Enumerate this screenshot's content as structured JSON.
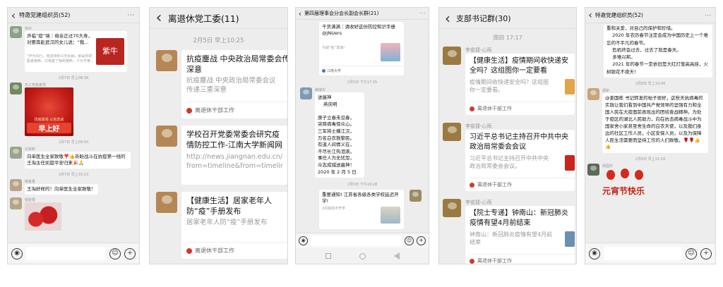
{
  "panels": {
    "p1": {
      "title": "特邀党建组织员(52)",
      "messages": [
        {
          "name": "林卉",
          "card_title": "声临“疫”境｜母亲正过70大寿，对要奔赴武汉的女儿说：“我...",
          "card_desc": "“作为同行，我支持你义无反顾，那是你的医者使命，只有能了我的使命，十分不舍...",
          "thumb_text": "紫牛"
        },
        {
          "time": "2月7日 早上08:38"
        },
        {
          "name": "天工党委委员",
          "image_text": "早上好",
          "image_subtext": "抗疫最强 以信念战"
        },
        {
          "time": "2月7日 早上09:50"
        },
        {
          "name": "过歌新",
          "text": "向单医生全家致敬❣️👍祈盼战斗在抗疫第一线的王淘主任凯旋平安归来🎉🙏"
        },
        {
          "time": "2月7日 早上10:23"
        },
        {
          "name": "郁金香",
          "text": "王淘好样的！向单医生全家致敬！"
        },
        {
          "name": "郁金香"
        }
      ]
    },
    "p2": {
      "title": "离退休党工委(11)",
      "time": "2月5日 早上10:25",
      "cards": [
        {
          "title": "抗疫鏖战 中央政治局常委会传递三重深意",
          "desc": "抗疫鏖战 中央政治局常委会议传递三重深意",
          "source": "离退休干部工作"
        },
        {
          "title": "学校召开党委常委会研究疫情防控工作-江南大学新闻网",
          "desc": "http://news.jiangnan.edu.cn/info/1074/64408.htm?from=timeline&from=timeline#..."
        },
        {
          "title": "【健康生活】居家老年人防“疫”手册发布",
          "desc": "居家老年人防“疫”手册发布",
          "source": "离退休干部工作"
        }
      ]
    },
    "p3": {
      "title": "第四届理事会分会长副会长群(21)",
      "top_card": {
        "title": "干货满满｜请收好这份防控知识手册@JNUers",
        "desc": "为战“疫”加油!",
        "source": "江南大学"
      },
      "time1": "2月5日 下午17:35",
      "poem": {
        "name": "朝瑞华",
        "lines": [
          "送瘟神",
          "燕庆明",
          "",
          "庚子立春未见春，",
          "突降病毒惊众心。",
          "三军将士播江汉，",
          "万名白衣救黎民。",
          "有道人间情义在，",
          "不尽长江热泪滚。",
          "事任人为无忧怨，",
          "众志成城送瘟神！",
          "2020 年 2 月 5 日"
        ]
      },
      "time2": "2月5日 下午19:28",
      "notice": {
        "title": "重要通知! 江苏省各级各类学校延迟开学!",
        "desc": "2月底前不开学"
      }
    },
    "p4": {
      "title": "支部书记群(30)",
      "time": "周四 17:17",
      "cards": [
        {
          "name": "李俊捷-心雨",
          "title": "【健康生活】疫情期间收快递安全吗？这组图你一定要看",
          "desc": "疫情期间收快递安全吗？这组图你一定要看。",
          "source": "离退休干部工作"
        },
        {
          "name": "李俊捷-心雨",
          "title": "习近平总书记主持召开中共中央政治局常委会会议",
          "desc": "习近平总书记主持召开中共中央政治局常委会会议。",
          "source": "离退休干部工作"
        },
        {
          "name": "李俊捷-心雨",
          "title": "【院士专递】钟南山：新冠肺炎疫情有望4月前结束",
          "desc": "钟南山：新冠肺炎疫情有望4月前结束",
          "source": "离退休干部工作"
        }
      ]
    },
    "p5": {
      "title": "特邀党建组织员(52)",
      "top_text": "重和关爱，对自己的保护和珍惜。\n    2020 年农历春节注定会成为中国历史上一个难忘的不平凡的春节。\n    危机终会过去，过去了就是春天。\n    多难兴邦。\n    2021 年的春节一定依旧是大红灯笼高高挂，火树银花不夜天！",
      "time1": "2月8日 早上10:49",
      "name1": "振新",
      "text1": "@姜国栋  书记转发的帖子很好，这些天抗病毒的实践让我们看到中国共产党领导的坚强有力和全国人民在大疫面前表现出的团结奋战精神。为处于疫区的湖北人民助力，向在抗击病毒战斗中为国家舍小家甚至舍生命的白衣天使，以及我们身边的社区工作人员，小区安保人员，以及为保障人民生活需要而坚持工作的人们致敬。🌹🌹👍👍",
      "time2": "2月8日 早上11:19",
      "name2": "杨国庆",
      "image_text": "元宵节快乐"
    }
  },
  "icons": {
    "back": "‹",
    "more": "···",
    "voice": "◉",
    "emoji": "☺",
    "plus": "+"
  },
  "colors": {
    "accent_red": "#d0382c",
    "wechat_bg": "#ededed"
  }
}
